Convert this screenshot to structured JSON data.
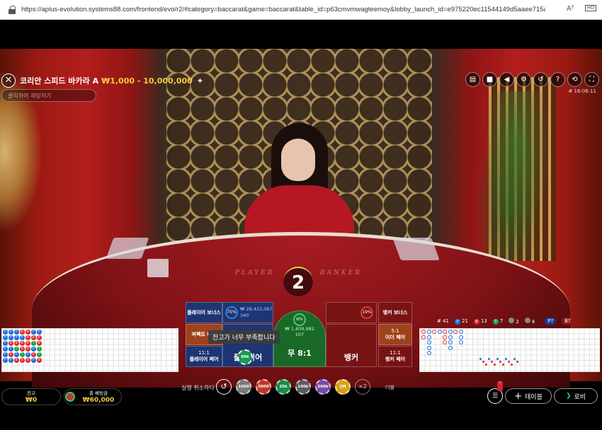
{
  "browser": {
    "url": "https://aplus-evolution.systems88.com/frontend/evo/r2/#category=baccarat&game=baccarat&table_id=p63cmvmwagteemoy&lobby_launch_id=e975220ec11544149d5aaee715a89154",
    "icons": [
      "lock-icon",
      "read-aloud-icon",
      "hd-icon"
    ],
    "read_aloud_label": "Aᵀ",
    "hd_label": "HD"
  },
  "header": {
    "title": "코리안 스피드 바카라 A",
    "limits": "₩1,000 - 10,000,000",
    "chat_placeholder": "클릭하여 채팅하기",
    "round_id": "# 16:06:11"
  },
  "top_icons": [
    "chat-icon",
    "video-icon",
    "sound-icon",
    "settings-icon",
    "history-icon",
    "help-icon",
    "rotate-icon",
    "fullscreen-icon"
  ],
  "timer": "2",
  "table_text": {
    "player": "PLAYER",
    "banker": "BANKER"
  },
  "bets": {
    "player_bonus": "플레이어 보너스",
    "banker_bonus": "뱅커 보너스",
    "perfect_pair": "퍼펙트 페어",
    "either_pair": "이더 페어",
    "either_pair_odds": "5:1",
    "player_pair": "플레이어 페어",
    "player_pair_odds": "11:1",
    "banker_pair": "뱅커 페어",
    "banker_pair_odds": "11:1",
    "player_pct": "75%",
    "player_amount": "₩ 28,422,067",
    "player_count": "340",
    "tie_pct": "6%",
    "tie_amount": "₩ 1,409,982",
    "tie_count": "107",
    "banker_pct": "19%",
    "player": "플레이어",
    "tie": "무 8:1",
    "banker": "뱅커"
  },
  "tooltip": "잔고가 너무 부족합니다",
  "placed_chip": "60k",
  "stats": {
    "total": "# 41",
    "player": "21",
    "banker": "13",
    "tie": "7",
    "player_pair": "2",
    "banker_pair": "4",
    "p_label": "P?",
    "b_label": "B?"
  },
  "controls": {
    "undo_label": "실행 취소하다",
    "repeat_label": "더블",
    "chips": [
      "1000",
      "5000",
      "25k",
      "100k",
      "500k",
      "1M"
    ],
    "x2": "×2",
    "chip_colors": [
      "#7a7a7a",
      "#c0392b",
      "#1e8a4a",
      "#5b5b5b",
      "#7a4aa8",
      "#d6a21e"
    ]
  },
  "wallet": {
    "balance_label": "잔고",
    "balance": "₩0",
    "total_bet_label": "총 베팅금",
    "total_bet": "₩60,000"
  },
  "nav": {
    "table_btn": "테이블",
    "lobby_btn": "로비",
    "badge": "7"
  },
  "colors": {
    "player": "#1a6fe0",
    "banker": "#e02b2b",
    "tie": "#1fa34a",
    "gold": "#f5c842"
  }
}
